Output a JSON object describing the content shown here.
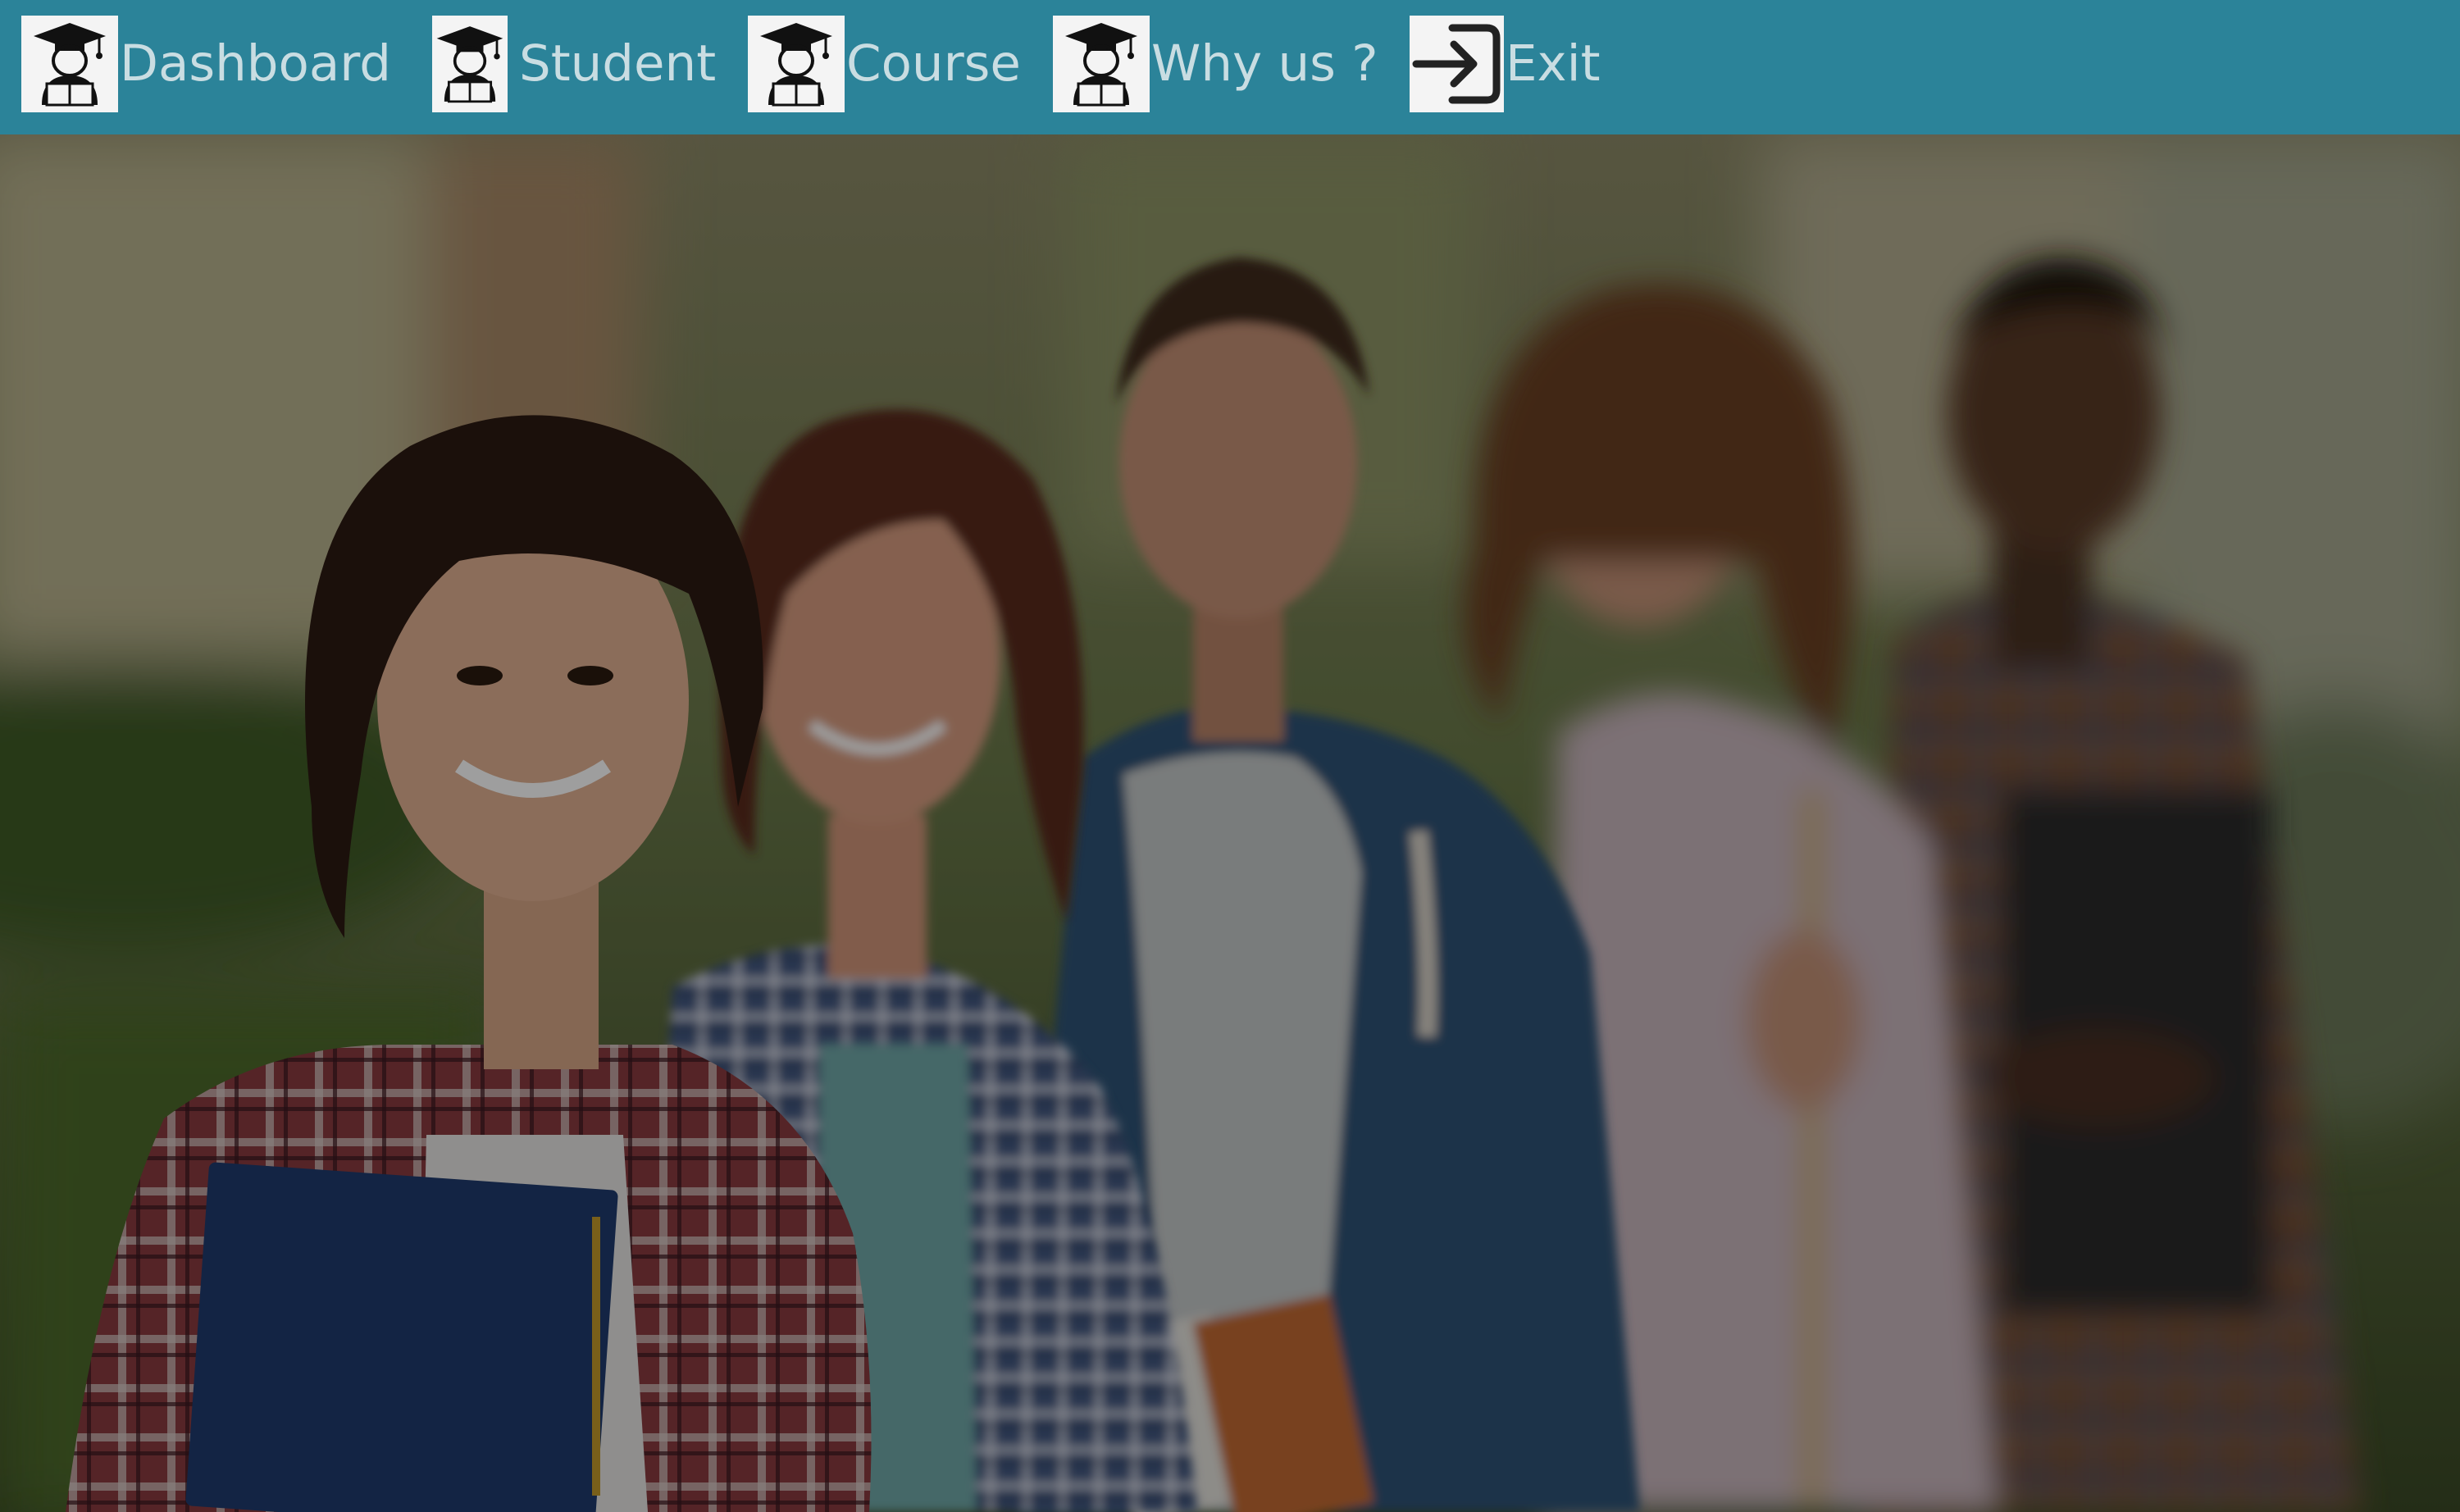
{
  "navbar": {
    "bg_color": "#2b8399",
    "label_color": "#c9dde2",
    "items": [
      {
        "label": "Dashboard",
        "icon": "graduate-student-icon"
      },
      {
        "label": "Student",
        "icon": "graduate-student-icon"
      },
      {
        "label": "Course",
        "icon": "graduate-student-icon"
      },
      {
        "label": "Why us ?",
        "icon": "graduate-student-icon"
      },
      {
        "label": "Exit",
        "icon": "exit-arrow-icon"
      }
    ]
  },
  "hero": {
    "image": "students-group-photo",
    "overlay": "dimmed"
  }
}
